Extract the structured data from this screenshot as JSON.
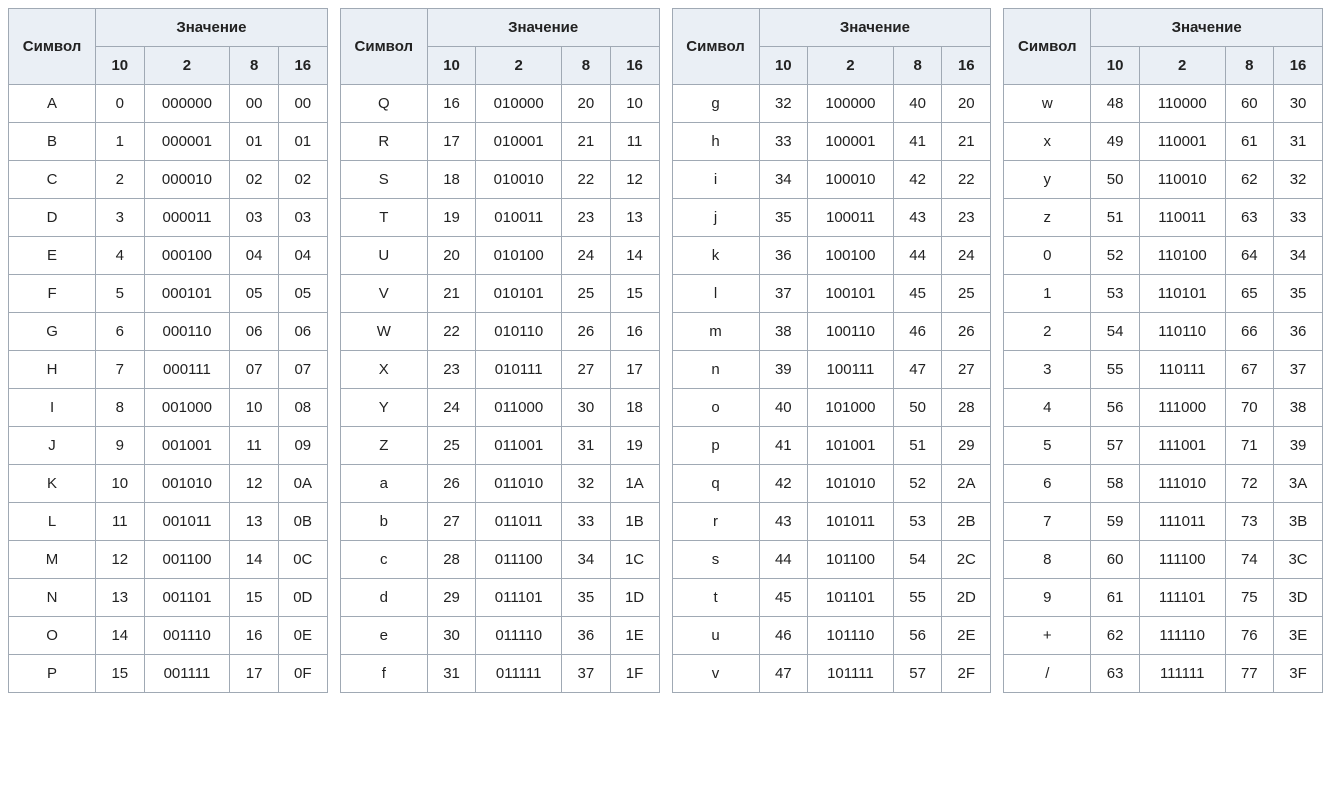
{
  "headers": {
    "symbol": "Символ",
    "value": "Значение",
    "base10": "10",
    "base2": "2",
    "base8": "8",
    "base16": "16"
  },
  "tables": [
    {
      "rows": [
        {
          "sym": "A",
          "d10": "0",
          "d2": "000000",
          "d8": "00",
          "d16": "00"
        },
        {
          "sym": "B",
          "d10": "1",
          "d2": "000001",
          "d8": "01",
          "d16": "01"
        },
        {
          "sym": "C",
          "d10": "2",
          "d2": "000010",
          "d8": "02",
          "d16": "02"
        },
        {
          "sym": "D",
          "d10": "3",
          "d2": "000011",
          "d8": "03",
          "d16": "03"
        },
        {
          "sym": "E",
          "d10": "4",
          "d2": "000100",
          "d8": "04",
          "d16": "04"
        },
        {
          "sym": "F",
          "d10": "5",
          "d2": "000101",
          "d8": "05",
          "d16": "05"
        },
        {
          "sym": "G",
          "d10": "6",
          "d2": "000110",
          "d8": "06",
          "d16": "06"
        },
        {
          "sym": "H",
          "d10": "7",
          "d2": "000111",
          "d8": "07",
          "d16": "07"
        },
        {
          "sym": "I",
          "d10": "8",
          "d2": "001000",
          "d8": "10",
          "d16": "08"
        },
        {
          "sym": "J",
          "d10": "9",
          "d2": "001001",
          "d8": "11",
          "d16": "09"
        },
        {
          "sym": "K",
          "d10": "10",
          "d2": "001010",
          "d8": "12",
          "d16": "0A"
        },
        {
          "sym": "L",
          "d10": "11",
          "d2": "001011",
          "d8": "13",
          "d16": "0B"
        },
        {
          "sym": "M",
          "d10": "12",
          "d2": "001100",
          "d8": "14",
          "d16": "0C"
        },
        {
          "sym": "N",
          "d10": "13",
          "d2": "001101",
          "d8": "15",
          "d16": "0D"
        },
        {
          "sym": "O",
          "d10": "14",
          "d2": "001110",
          "d8": "16",
          "d16": "0E"
        },
        {
          "sym": "P",
          "d10": "15",
          "d2": "001111",
          "d8": "17",
          "d16": "0F"
        }
      ]
    },
    {
      "rows": [
        {
          "sym": "Q",
          "d10": "16",
          "d2": "010000",
          "d8": "20",
          "d16": "10"
        },
        {
          "sym": "R",
          "d10": "17",
          "d2": "010001",
          "d8": "21",
          "d16": "11"
        },
        {
          "sym": "S",
          "d10": "18",
          "d2": "010010",
          "d8": "22",
          "d16": "12"
        },
        {
          "sym": "T",
          "d10": "19",
          "d2": "010011",
          "d8": "23",
          "d16": "13"
        },
        {
          "sym": "U",
          "d10": "20",
          "d2": "010100",
          "d8": "24",
          "d16": "14"
        },
        {
          "sym": "V",
          "d10": "21",
          "d2": "010101",
          "d8": "25",
          "d16": "15"
        },
        {
          "sym": "W",
          "d10": "22",
          "d2": "010110",
          "d8": "26",
          "d16": "16"
        },
        {
          "sym": "X",
          "d10": "23",
          "d2": "010111",
          "d8": "27",
          "d16": "17"
        },
        {
          "sym": "Y",
          "d10": "24",
          "d2": "011000",
          "d8": "30",
          "d16": "18"
        },
        {
          "sym": "Z",
          "d10": "25",
          "d2": "011001",
          "d8": "31",
          "d16": "19"
        },
        {
          "sym": "a",
          "d10": "26",
          "d2": "011010",
          "d8": "32",
          "d16": "1A"
        },
        {
          "sym": "b",
          "d10": "27",
          "d2": "011011",
          "d8": "33",
          "d16": "1B"
        },
        {
          "sym": "c",
          "d10": "28",
          "d2": "011100",
          "d8": "34",
          "d16": "1C"
        },
        {
          "sym": "d",
          "d10": "29",
          "d2": "011101",
          "d8": "35",
          "d16": "1D"
        },
        {
          "sym": "e",
          "d10": "30",
          "d2": "011110",
          "d8": "36",
          "d16": "1E"
        },
        {
          "sym": "f",
          "d10": "31",
          "d2": "011111",
          "d8": "37",
          "d16": "1F"
        }
      ]
    },
    {
      "rows": [
        {
          "sym": "g",
          "d10": "32",
          "d2": "100000",
          "d8": "40",
          "d16": "20"
        },
        {
          "sym": "h",
          "d10": "33",
          "d2": "100001",
          "d8": "41",
          "d16": "21"
        },
        {
          "sym": "i",
          "d10": "34",
          "d2": "100010",
          "d8": "42",
          "d16": "22"
        },
        {
          "sym": "j",
          "d10": "35",
          "d2": "100011",
          "d8": "43",
          "d16": "23"
        },
        {
          "sym": "k",
          "d10": "36",
          "d2": "100100",
          "d8": "44",
          "d16": "24"
        },
        {
          "sym": "l",
          "d10": "37",
          "d2": "100101",
          "d8": "45",
          "d16": "25"
        },
        {
          "sym": "m",
          "d10": "38",
          "d2": "100110",
          "d8": "46",
          "d16": "26"
        },
        {
          "sym": "n",
          "d10": "39",
          "d2": "100111",
          "d8": "47",
          "d16": "27"
        },
        {
          "sym": "o",
          "d10": "40",
          "d2": "101000",
          "d8": "50",
          "d16": "28"
        },
        {
          "sym": "p",
          "d10": "41",
          "d2": "101001",
          "d8": "51",
          "d16": "29"
        },
        {
          "sym": "q",
          "d10": "42",
          "d2": "101010",
          "d8": "52",
          "d16": "2A"
        },
        {
          "sym": "r",
          "d10": "43",
          "d2": "101011",
          "d8": "53",
          "d16": "2B"
        },
        {
          "sym": "s",
          "d10": "44",
          "d2": "101100",
          "d8": "54",
          "d16": "2C"
        },
        {
          "sym": "t",
          "d10": "45",
          "d2": "101101",
          "d8": "55",
          "d16": "2D"
        },
        {
          "sym": "u",
          "d10": "46",
          "d2": "101110",
          "d8": "56",
          "d16": "2E"
        },
        {
          "sym": "v",
          "d10": "47",
          "d2": "101111",
          "d8": "57",
          "d16": "2F"
        }
      ]
    },
    {
      "rows": [
        {
          "sym": "w",
          "d10": "48",
          "d2": "110000",
          "d8": "60",
          "d16": "30"
        },
        {
          "sym": "x",
          "d10": "49",
          "d2": "110001",
          "d8": "61",
          "d16": "31"
        },
        {
          "sym": "y",
          "d10": "50",
          "d2": "110010",
          "d8": "62",
          "d16": "32"
        },
        {
          "sym": "z",
          "d10": "51",
          "d2": "110011",
          "d8": "63",
          "d16": "33"
        },
        {
          "sym": "0",
          "d10": "52",
          "d2": "110100",
          "d8": "64",
          "d16": "34"
        },
        {
          "sym": "1",
          "d10": "53",
          "d2": "110101",
          "d8": "65",
          "d16": "35"
        },
        {
          "sym": "2",
          "d10": "54",
          "d2": "110110",
          "d8": "66",
          "d16": "36"
        },
        {
          "sym": "3",
          "d10": "55",
          "d2": "110111",
          "d8": "67",
          "d16": "37"
        },
        {
          "sym": "4",
          "d10": "56",
          "d2": "111000",
          "d8": "70",
          "d16": "38"
        },
        {
          "sym": "5",
          "d10": "57",
          "d2": "111001",
          "d8": "71",
          "d16": "39"
        },
        {
          "sym": "6",
          "d10": "58",
          "d2": "111010",
          "d8": "72",
          "d16": "3A"
        },
        {
          "sym": "7",
          "d10": "59",
          "d2": "111011",
          "d8": "73",
          "d16": "3B"
        },
        {
          "sym": "8",
          "d10": "60",
          "d2": "111100",
          "d8": "74",
          "d16": "3C"
        },
        {
          "sym": "9",
          "d10": "61",
          "d2": "111101",
          "d8": "75",
          "d16": "3D"
        },
        {
          "sym": "+",
          "d10": "62",
          "d2": "111110",
          "d8": "76",
          "d16": "3E"
        },
        {
          "sym": "/",
          "d10": "63",
          "d2": "111111",
          "d8": "77",
          "d16": "3F"
        }
      ]
    }
  ]
}
